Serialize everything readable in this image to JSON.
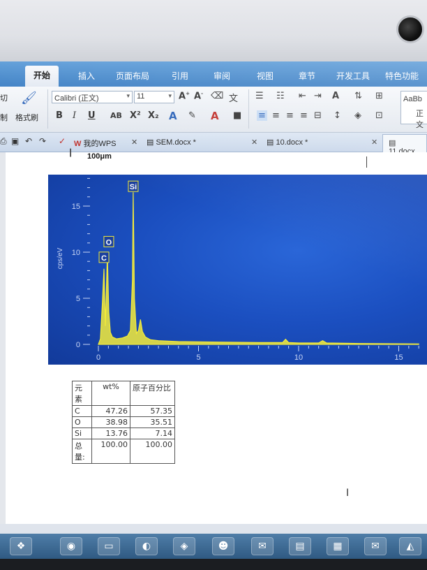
{
  "ribbon": {
    "tabs": [
      "开始",
      "插入",
      "页面布局",
      "引用",
      "审阅",
      "视图",
      "章节",
      "开发工具",
      "特色功能"
    ],
    "clipboard": {
      "cut": "切",
      "copy": "制",
      "format_painter": "格式刷"
    },
    "font": {
      "name": "Calibri (正文)",
      "size": "11"
    },
    "style_preview": {
      "sample": "AaBb",
      "name": "正文"
    }
  },
  "doc_tabs": [
    {
      "label": "我的WPS",
      "active": false
    },
    {
      "label": "SEM.docx *",
      "active": false
    },
    {
      "label": "10.docx *",
      "active": false
    },
    {
      "label": "11.docx",
      "active": true
    }
  ],
  "document": {
    "scale_label": "100μm",
    "spectrum": {
      "chart_data": {
        "type": "line",
        "xlabel": "",
        "ylabel": "cps/eV",
        "xlim": [
          0,
          16
        ],
        "ylim": [
          0,
          18
        ],
        "x_ticks": [
          0,
          5,
          10,
          15
        ],
        "y_ticks": [
          0,
          5,
          10,
          15
        ],
        "grid": false,
        "series": [
          {
            "x": [
              0,
              0.1,
              0.2,
              0.28,
              0.35,
              0.45,
              0.52,
              0.6,
              0.7,
              0.9,
              1.2,
              1.45,
              1.6,
              1.7,
              1.74,
              1.8,
              1.9,
              2.0,
              2.1,
              2.2,
              2.35,
              2.6,
              3.0,
              4.0,
              6.0,
              8.0,
              9.2,
              9.35,
              9.5,
              10.0,
              11.0,
              11.2,
              11.4,
              13.0,
              16.0
            ],
            "y": [
              0,
              0.6,
              4.5,
              8.2,
              2.0,
              9.8,
              3.5,
              1.3,
              0.8,
              0.6,
              0.7,
              0.9,
              1.5,
              7.0,
              16.5,
              5.0,
              1.2,
              1.5,
              2.7,
              1.4,
              0.8,
              0.5,
              0.4,
              0.3,
              0.25,
              0.2,
              0.2,
              0.55,
              0.2,
              0.15,
              0.15,
              0.4,
              0.15,
              0.1,
              0.05
            ]
          }
        ],
        "annotations": [
          {
            "label": "Si",
            "x": 1.74,
            "y": 16.5
          },
          {
            "label": "O",
            "x": 0.52,
            "y": 10.5
          },
          {
            "label": "C",
            "x": 0.28,
            "y": 8.8
          }
        ],
        "colors": {
          "line": "#f4ec3a",
          "background": "#1b4fc0",
          "axis": "#c9d6f5"
        }
      }
    },
    "table": {
      "header": [
        "元素",
        "wt%",
        "原子百分比"
      ],
      "rows": [
        [
          "C",
          "47.26",
          "57.35"
        ],
        [
          "O",
          "38.98",
          "35.51"
        ],
        [
          "Si",
          "13.76",
          "7.14"
        ],
        [
          "总量:",
          "100.00",
          "100.00"
        ]
      ]
    }
  }
}
